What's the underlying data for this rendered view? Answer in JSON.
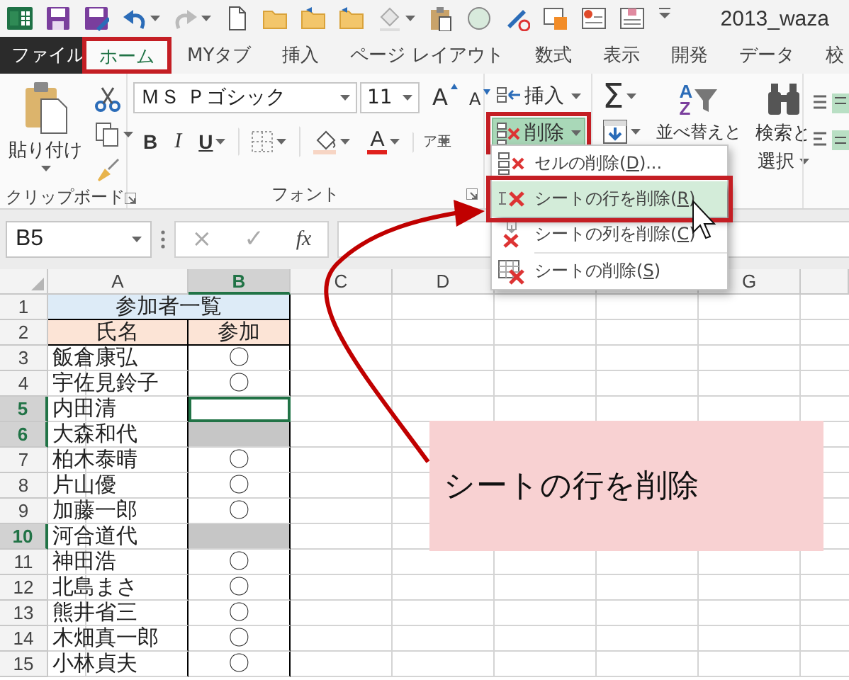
{
  "quick_access": {
    "title": "2013_waza"
  },
  "tabs": [
    {
      "label": "ファイル",
      "kind": "file",
      "selected": false,
      "annotated": false
    },
    {
      "label": "ホーム",
      "kind": "tab",
      "selected": true,
      "annotated": true
    },
    {
      "label": "MYタブ",
      "kind": "tab",
      "selected": false,
      "annotated": false
    },
    {
      "label": "挿入",
      "kind": "tab",
      "selected": false,
      "annotated": false
    },
    {
      "label": "ページ レイアウト",
      "kind": "tab",
      "selected": false,
      "annotated": false
    },
    {
      "label": "数式",
      "kind": "tab",
      "selected": false,
      "annotated": false
    },
    {
      "label": "表示",
      "kind": "tab",
      "selected": false,
      "annotated": false
    },
    {
      "label": "開発",
      "kind": "tab",
      "selected": false,
      "annotated": false
    },
    {
      "label": "データ",
      "kind": "tab",
      "selected": false,
      "annotated": false
    },
    {
      "label": "校",
      "kind": "tab",
      "selected": false,
      "annotated": false
    }
  ],
  "ribbon": {
    "clipboard": {
      "paste": "貼り付け",
      "label": "クリップボード"
    },
    "font": {
      "name": "ＭＳ Ｐゴシック",
      "size": "11",
      "grow": "A",
      "shrink": "A",
      "bold": "B",
      "italic": "I",
      "underline": "U",
      "color_letter": "A",
      "phonetic": "ア亜",
      "label": "フォント"
    },
    "cells": [
      {
        "label": "挿入",
        "pressed": false,
        "annotated": false
      },
      {
        "label": "削除",
        "pressed": true,
        "annotated": true
      }
    ],
    "editing": {
      "sum": "Σ",
      "sort_letters": [
        "A",
        "Z"
      ],
      "sort": "並べ替えと",
      "find": "検索と",
      "select": "選択"
    }
  },
  "menu": [
    {
      "before": "セルの削除(",
      "key": "D",
      "after": ")...",
      "selected": false,
      "annotated": false
    },
    {
      "before": "シートの行を削除(",
      "key": "R",
      "after": ")",
      "selected": true,
      "annotated": true
    },
    {
      "before": "シートの列を削除(",
      "key": "C",
      "after": ")",
      "selected": false,
      "annotated": false
    },
    {
      "before": "シートの削除(",
      "key": "S",
      "after": ")",
      "selected": false,
      "annotated": false
    }
  ],
  "formula_bar": {
    "name_box": "B5",
    "cancel": "×",
    "enter": "✓",
    "function": "fx"
  },
  "sheet": {
    "columns": [
      {
        "kind": "letter",
        "label": "A",
        "selected": false
      },
      {
        "kind": "letter",
        "label": "B",
        "selected": true
      },
      {
        "kind": "letter",
        "label": "C",
        "selected": false
      },
      {
        "kind": "letter",
        "label": "D",
        "selected": false
      },
      {
        "kind": "covered",
        "selected": false
      },
      {
        "kind": "covered",
        "selected": false
      },
      {
        "kind": "letter",
        "label": "G",
        "selected": false
      },
      {
        "kind": "covered",
        "selected": false
      }
    ],
    "rows": [
      {
        "number": "1",
        "kind": "title",
        "selected": false,
        "text": "参加者一覧"
      },
      {
        "number": "2",
        "kind": "header",
        "selected": false,
        "cells": [
          "氏名",
          "参加"
        ]
      },
      {
        "number": "3",
        "kind": "data",
        "selected": false,
        "name": "飯倉康弘",
        "mark": "〇",
        "active": false,
        "in_selection": false
      },
      {
        "number": "4",
        "kind": "data",
        "selected": false,
        "name": "宇佐見鈴子",
        "mark": "〇",
        "active": false,
        "in_selection": false
      },
      {
        "number": "5",
        "kind": "data",
        "selected": true,
        "name": "内田清",
        "active": true
      },
      {
        "number": "6",
        "kind": "data",
        "selected": true,
        "name": "大森和代",
        "active": false,
        "in_selection": true
      },
      {
        "number": "7",
        "kind": "data",
        "selected": false,
        "name": "柏木泰晴",
        "mark": "〇",
        "active": false,
        "in_selection": false
      },
      {
        "number": "8",
        "kind": "data",
        "selected": false,
        "name": "片山優",
        "mark": "〇",
        "active": false,
        "in_selection": false
      },
      {
        "number": "9",
        "kind": "data",
        "selected": false,
        "name": "加藤一郎",
        "mark": "〇",
        "active": false,
        "in_selection": false
      },
      {
        "number": "10",
        "kind": "data",
        "selected": true,
        "name": "河合道代",
        "active": false,
        "in_selection": true
      },
      {
        "number": "11",
        "kind": "data",
        "selected": false,
        "name": "神田浩",
        "mark": "〇",
        "active": false,
        "in_selection": false
      },
      {
        "number": "12",
        "kind": "data",
        "selected": false,
        "name": "北島まさ",
        "mark": "〇",
        "active": false,
        "in_selection": false
      },
      {
        "number": "13",
        "kind": "data",
        "selected": false,
        "name": "熊井省三",
        "mark": "〇",
        "active": false,
        "in_selection": false
      },
      {
        "number": "14",
        "kind": "data",
        "selected": false,
        "name": "木畑真一郎",
        "mark": "〇",
        "active": false,
        "in_selection": false
      },
      {
        "number": "15",
        "kind": "data",
        "selected": false,
        "name": "小林貞夫",
        "mark": "〇",
        "active": false,
        "in_selection": false
      }
    ]
  },
  "callout": {
    "text": "シートの行を削除"
  }
}
